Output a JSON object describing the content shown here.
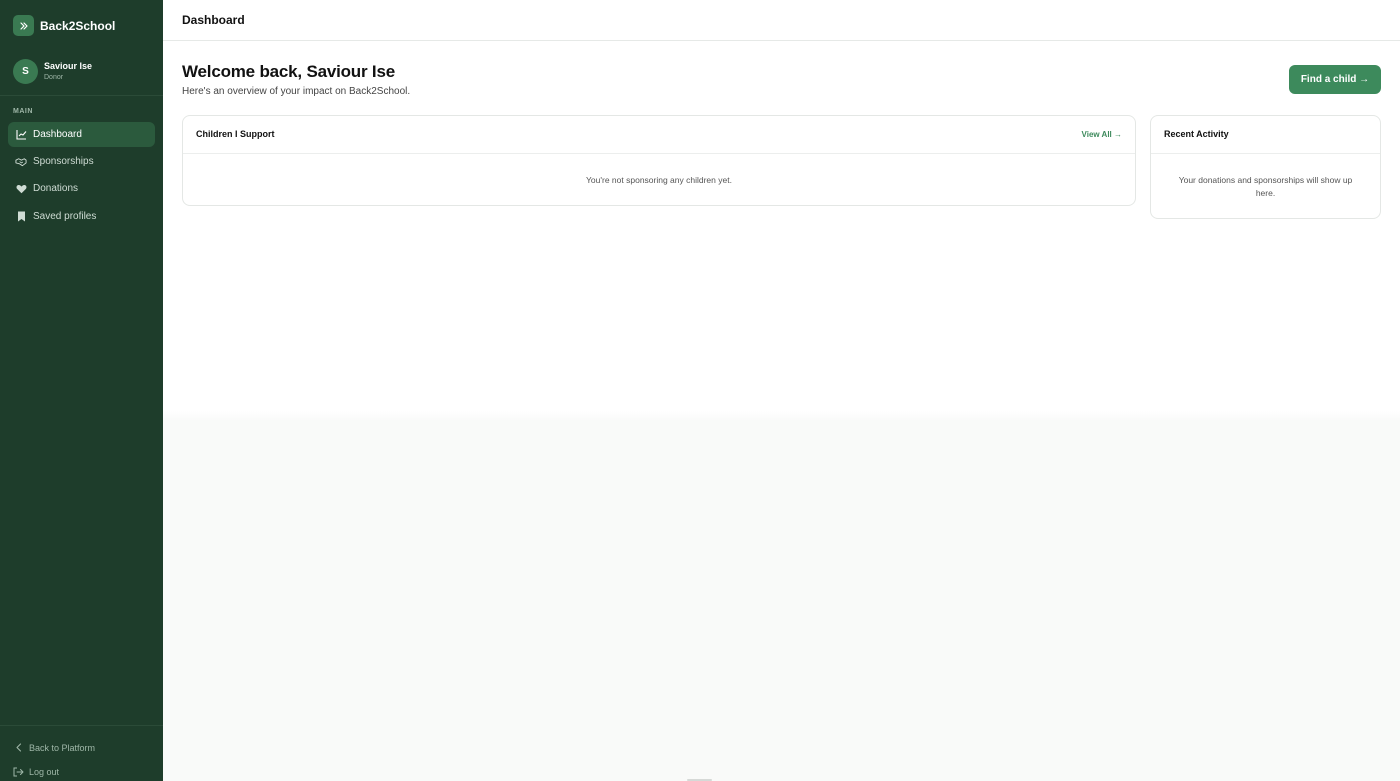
{
  "brand": {
    "name": "Back2School",
    "toggle_icon": "chevrons-right-icon"
  },
  "user": {
    "initial": "S",
    "name": "Saviour Ise",
    "role": "Donor"
  },
  "sidebar": {
    "section_label": "MAIN",
    "items": [
      {
        "label": "Dashboard",
        "icon": "chart-line-icon",
        "active": true
      },
      {
        "label": "Sponsorships",
        "icon": "handshake-icon",
        "active": false
      },
      {
        "label": "Donations",
        "icon": "heart-icon",
        "active": false
      },
      {
        "label": "Saved profiles",
        "icon": "bookmark-icon",
        "active": false
      }
    ],
    "footer": [
      {
        "label": "Back to Platform",
        "icon": "chevron-left-icon"
      },
      {
        "label": "Log out",
        "icon": "logout-icon"
      }
    ]
  },
  "topbar": {
    "title": "Dashboard"
  },
  "main": {
    "welcome_title": "Welcome back, Saviour Ise",
    "welcome_subtitle": "Here's an overview of your impact on Back2School.",
    "cta_label": "Find a child →",
    "children_card": {
      "title": "Children I Support",
      "link": "View All →",
      "empty_text": "You're not sponsoring any children yet."
    },
    "activity_card": {
      "title": "Recent Activity",
      "empty_text": "Your donations and sponsorships will show up here."
    }
  },
  "colors": {
    "sidebar_bg": "#1e3d2b",
    "accent": "#3d8a5c",
    "active_item_bg": "#2b5a3d"
  }
}
